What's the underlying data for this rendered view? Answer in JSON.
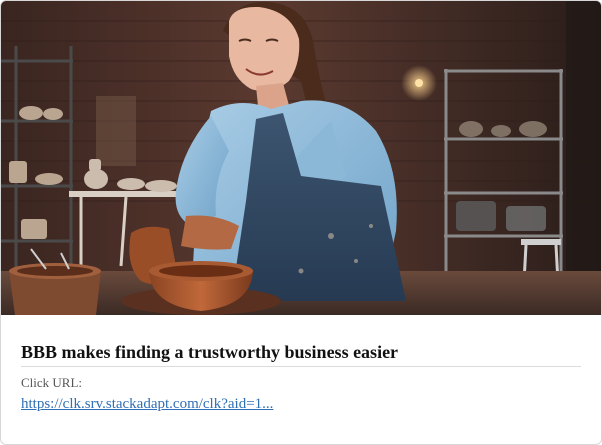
{
  "ad": {
    "headline": "BBB makes finding a trustworthy business easier",
    "click_url_label": "Click URL:",
    "click_url_text": "https://clk.srv.stackadapt.com/clk?aid=1..."
  },
  "colors": {
    "link": "#2f6fb5",
    "headline": "#111111",
    "label": "#555555",
    "border": "#d7d7d7"
  }
}
